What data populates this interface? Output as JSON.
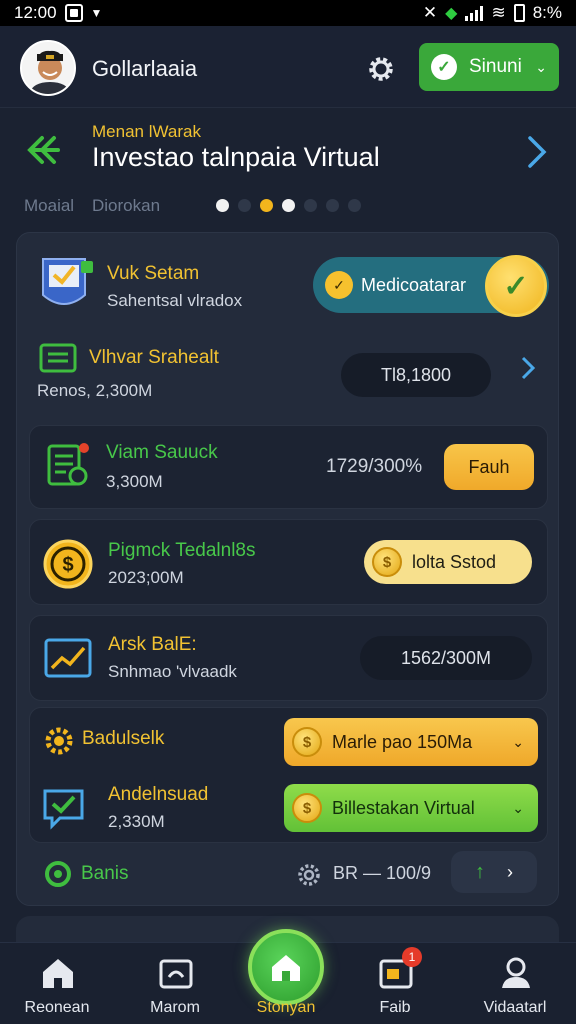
{
  "status_bar": {
    "time": "12:00",
    "battery": "8:%"
  },
  "header": {
    "app_title": "Gollarlaaia",
    "sync_label": "Sinuni"
  },
  "topnav": {
    "subtitle": "Menan lWarak",
    "title": "Investao talnpaia Virtual",
    "tab_a": "Moaial",
    "tab_b": "Diorokan",
    "dots": [
      "white",
      "dark",
      "yellow",
      "white",
      "dark",
      "dark",
      "dark"
    ]
  },
  "rows": [
    {
      "name": "Vuk Setam",
      "sub": "Sahentsal vlradox",
      "button": "Medicoatarar"
    },
    {
      "name": "Vlhvar Srahealt",
      "sub": "Renos, 2,300M",
      "value": "Tl8,1800"
    },
    {
      "name": "Viam Sauuck",
      "sub": "3,300M",
      "value": "1729/300%",
      "button": "Fauh"
    },
    {
      "name": "Pigmck Tedalnl8s",
      "sub": "2023;00M",
      "button": "lolta Sstod"
    },
    {
      "name": "Arsk BalE:",
      "sub": "Snhmao 'vlvaadk",
      "value": "1562/300M"
    },
    {
      "name": "Badulselk",
      "dropdown": "Marle pao 150Ma"
    },
    {
      "name": "Andelnsuad",
      "sub": "2,330M",
      "dropdown": "Billestakan Virtual"
    },
    {
      "name": "Banis",
      "value": "BR — 100/9"
    }
  ],
  "bottom_nav": [
    {
      "label": "Reonean",
      "icon": "home-icon"
    },
    {
      "label": "Marom",
      "icon": "wallet-icon"
    },
    {
      "label": "Stonyan",
      "icon": "center-home-icon"
    },
    {
      "label": "Faib",
      "icon": "card-icon",
      "badge": "1"
    },
    {
      "label": "Vidaatarl",
      "icon": "user-icon"
    }
  ],
  "colors": {
    "accent_green": "#3aa83a",
    "accent_yellow": "#f1c232",
    "background": "#1b2231"
  }
}
